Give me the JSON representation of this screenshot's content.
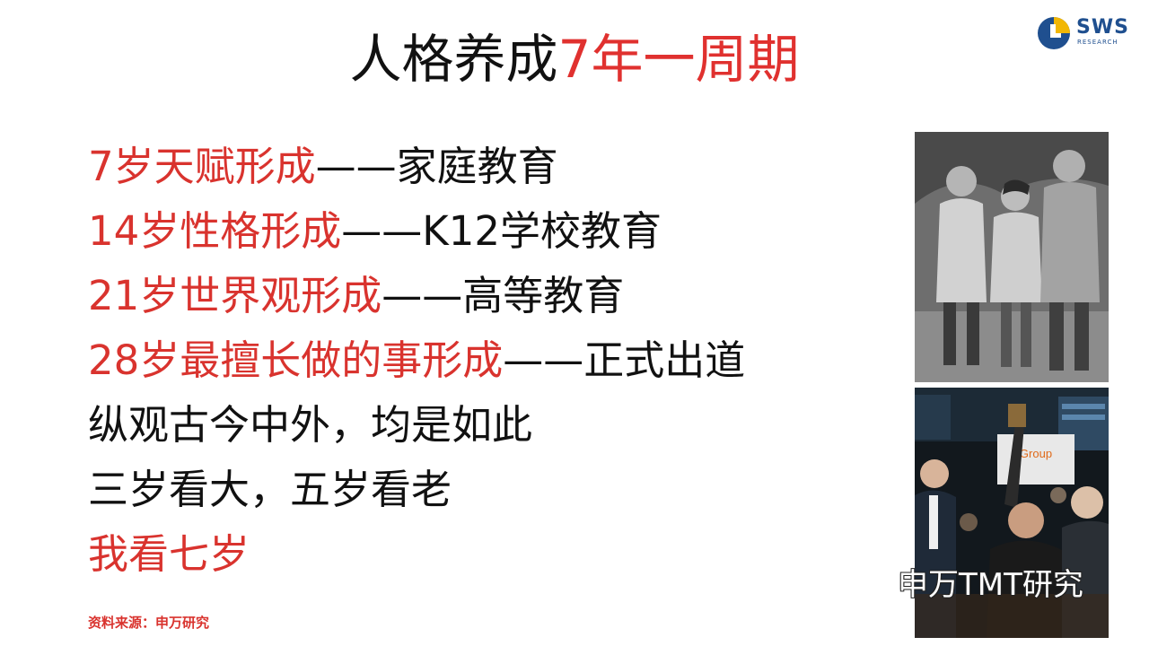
{
  "title": {
    "part1": "人格养成",
    "part2": "7年一周期"
  },
  "logo": {
    "text": "SWS",
    "subtext": "RESEARCH"
  },
  "lines": [
    {
      "red": "7岁天赋形成",
      "black": "——家庭教育"
    },
    {
      "red": "14岁性格形成",
      "black": "——K12学校教育"
    },
    {
      "red": "21岁世界观形成",
      "black": "——高等教育"
    },
    {
      "red": "28岁最擅长做的事形成",
      "black": "——正式出道"
    },
    {
      "text": "纵观古今中外，均是如此"
    },
    {
      "text": "三岁看大，五岁看老"
    },
    {
      "text": "我看七岁"
    }
  ],
  "source": "资料来源：申万研究",
  "photo_bottom": {
    "banner_text": "Group"
  },
  "watermark": "申万TMT研究",
  "colors": {
    "red": "#d9332e",
    "black": "#111111",
    "logo_blue": "#1f4f8f",
    "logo_gold": "#f2b705"
  }
}
